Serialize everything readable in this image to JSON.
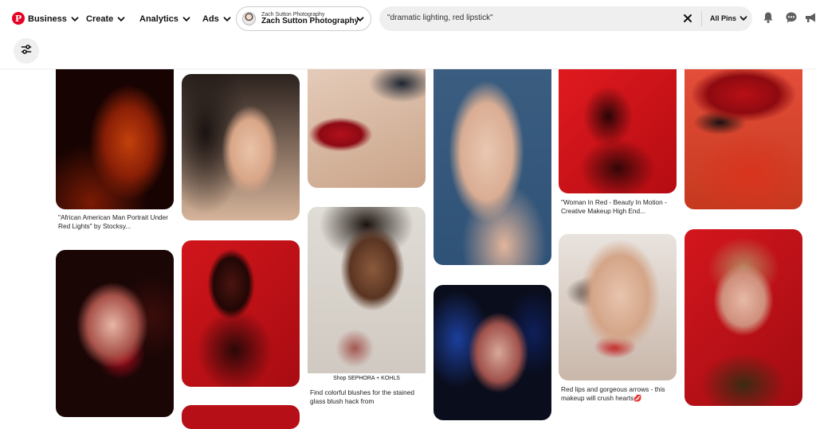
{
  "header": {
    "logo_letter": "P",
    "nav": [
      {
        "label": "Business"
      },
      {
        "label": "Create"
      },
      {
        "label": "Analytics"
      },
      {
        "label": "Ads"
      }
    ],
    "profile": {
      "small": "Zach Sutton Photography",
      "big": "Zach Sutton Photography"
    },
    "search": {
      "value": "\"dramatic lighting, red lipstick\"",
      "scope": "All Pins"
    },
    "icons": [
      "bell-icon",
      "messages-icon",
      "megaphone-icon"
    ]
  },
  "pins": [
    {
      "caption": "\"African American Man Portrait Under Red Lights\" by Stocksy..."
    },
    {
      "caption": ""
    },
    {
      "caption": ""
    },
    {
      "caption": "Find colorful blushes for the stained glass blush hack from"
    },
    {
      "caption": ""
    },
    {
      "caption": ""
    },
    {
      "caption": "\"Woman In Red - Beauty In Motion - Creative Makeup High End..."
    },
    {
      "caption": "Red lips and gorgeous arrows - this makeup will crush hearts💋"
    },
    {
      "caption": ""
    },
    {
      "caption": ""
    },
    {
      "caption": ""
    },
    {
      "caption": ""
    },
    {
      "caption": ""
    }
  ],
  "shop_bar": "Shop SEPHORA + KOHLS",
  "colors": {
    "brand": "#e60023",
    "search_bg": "#efefef"
  }
}
